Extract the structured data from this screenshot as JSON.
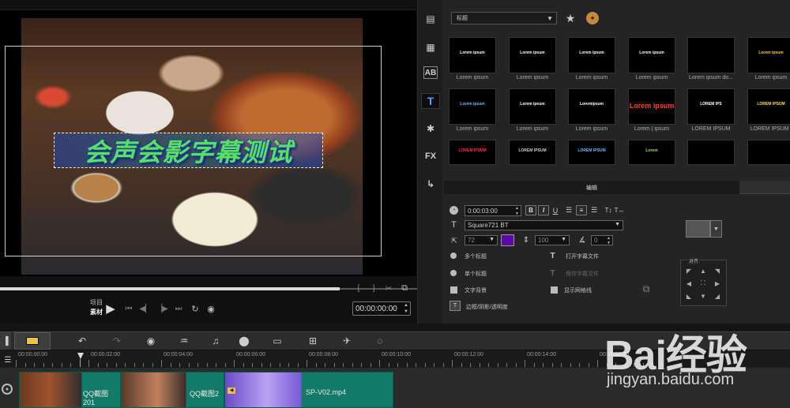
{
  "preview": {
    "title_overlay_text": "会声会影字幕测试",
    "mode_labels": [
      "项目",
      "素材"
    ],
    "timecode": "00:00:00:00"
  },
  "library": {
    "dropdown_value": "标题",
    "thumbnails_row1": [
      {
        "preview": "Lorem ipsum",
        "label": "Lorem ipsum",
        "color": "#ffffff"
      },
      {
        "preview": "Lorem ipsum",
        "label": "Lorem ipsum",
        "color": "#ffffff"
      },
      {
        "preview": "Lorem ipsum",
        "label": "Lorem ipsum",
        "color": "#ffffff"
      },
      {
        "preview": "Lorem ipsum",
        "label": "Lorem ipsum",
        "color": "#ffffff"
      },
      {
        "preview": "",
        "label": "Lorem ipsum do...",
        "color": "#ffffff"
      },
      {
        "preview": "Lorem ipsum",
        "label": "Lorem ipsum",
        "color": "#ffcc33"
      }
    ],
    "thumbnails_row2": [
      {
        "preview": "Lorem ipsum",
        "label": "Lorem ipsum",
        "color": "#6fb6ff"
      },
      {
        "preview": "Lorem ipsum",
        "label": "Lorem ipsum",
        "color": "#ffffff"
      },
      {
        "preview": "Loremipsum",
        "label": "Lorem ipsum",
        "color": "#ffffff"
      },
      {
        "preview": "Lorem ipsum",
        "label": "Lorem | ipsum",
        "color": "#ff4422"
      },
      {
        "preview": "LOREM IPS",
        "label": "LOREM IPSUM",
        "color": "#ffffff"
      },
      {
        "preview": "LOREM IPSUM",
        "label": "LOREM IPSUM |",
        "color": "#ffdd44"
      }
    ],
    "thumbnails_row3": [
      {
        "preview": "LOREM IPSUM",
        "color": "#ff3355"
      },
      {
        "preview": "LOREM IPSUM",
        "color": "#cccccc"
      },
      {
        "preview": "LOREM IPSUM",
        "color": "#6fb6ff"
      },
      {
        "preview": "Lorem",
        "color": "#9adf6a"
      },
      {
        "preview": "",
        "color": "#ffffff"
      },
      {
        "preview": "",
        "color": "#ffffff"
      }
    ]
  },
  "options": {
    "tab_label": "编辑",
    "duration": "0:00:03:00",
    "font_name": "Square721 BT",
    "font_size": "72",
    "color_swatch": "#5b0aa8",
    "line_spacing": "100",
    "angle": "0",
    "multi_title": "多个标题",
    "single_title": "单个标题",
    "open_subtitle_file": "打开字幕文件",
    "save_subtitle_file": "保存字幕文件",
    "text_background": "文字背景",
    "show_grid": "显示网格线",
    "border_shadow": "边框/阴影/透明度",
    "align_label": "对齐"
  },
  "timeline": {
    "ticks": [
      "00:00:00:00",
      "00:00:02:00",
      "00:00:04:00",
      "00:00:06:00",
      "00:00:08:00",
      "00:00:10:00",
      "00:00:12:00",
      "00:00:14:00",
      "00:00:16:00"
    ],
    "clips": [
      "QQ截图201",
      "QQ截图2",
      "SP-V02.mp4"
    ]
  },
  "watermark": {
    "logo": "Bai经验",
    "url": "jingyan.baidu.com"
  }
}
